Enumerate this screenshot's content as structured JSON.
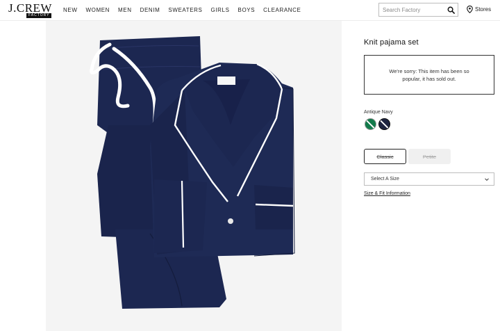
{
  "brand": {
    "name": "J.CREW",
    "sub": "FACTORY"
  },
  "nav": {
    "items": [
      "NEW",
      "WOMEN",
      "MEN",
      "DENIM",
      "SWEATERS",
      "GIRLS",
      "BOYS",
      "CLEARANCE"
    ]
  },
  "search": {
    "placeholder": "Search Factory",
    "icon": "search-icon"
  },
  "stores": {
    "label": "Stores",
    "icon": "map-pin-icon"
  },
  "product": {
    "title": "Knit pajama set",
    "sold_out_message": "We're sorry: This item has been so popular, it has sold out.",
    "color_name": "Antique Navy",
    "swatches": [
      {
        "name": "green",
        "color": "#127a4a"
      },
      {
        "name": "antique-navy",
        "color": "#1d2440",
        "selected": true
      }
    ],
    "fits": [
      {
        "label": "Classic",
        "selected": true,
        "unavailable": true
      },
      {
        "label": "Petite",
        "selected": false,
        "unavailable": true
      }
    ],
    "size_select": {
      "label": "Select A Size",
      "icon": "chevron-down-icon"
    },
    "size_link": "Size & Fit Information",
    "image_colors": {
      "fabric": "#1c2751",
      "piping": "#ffffff",
      "background": "#f4f4f4"
    }
  }
}
